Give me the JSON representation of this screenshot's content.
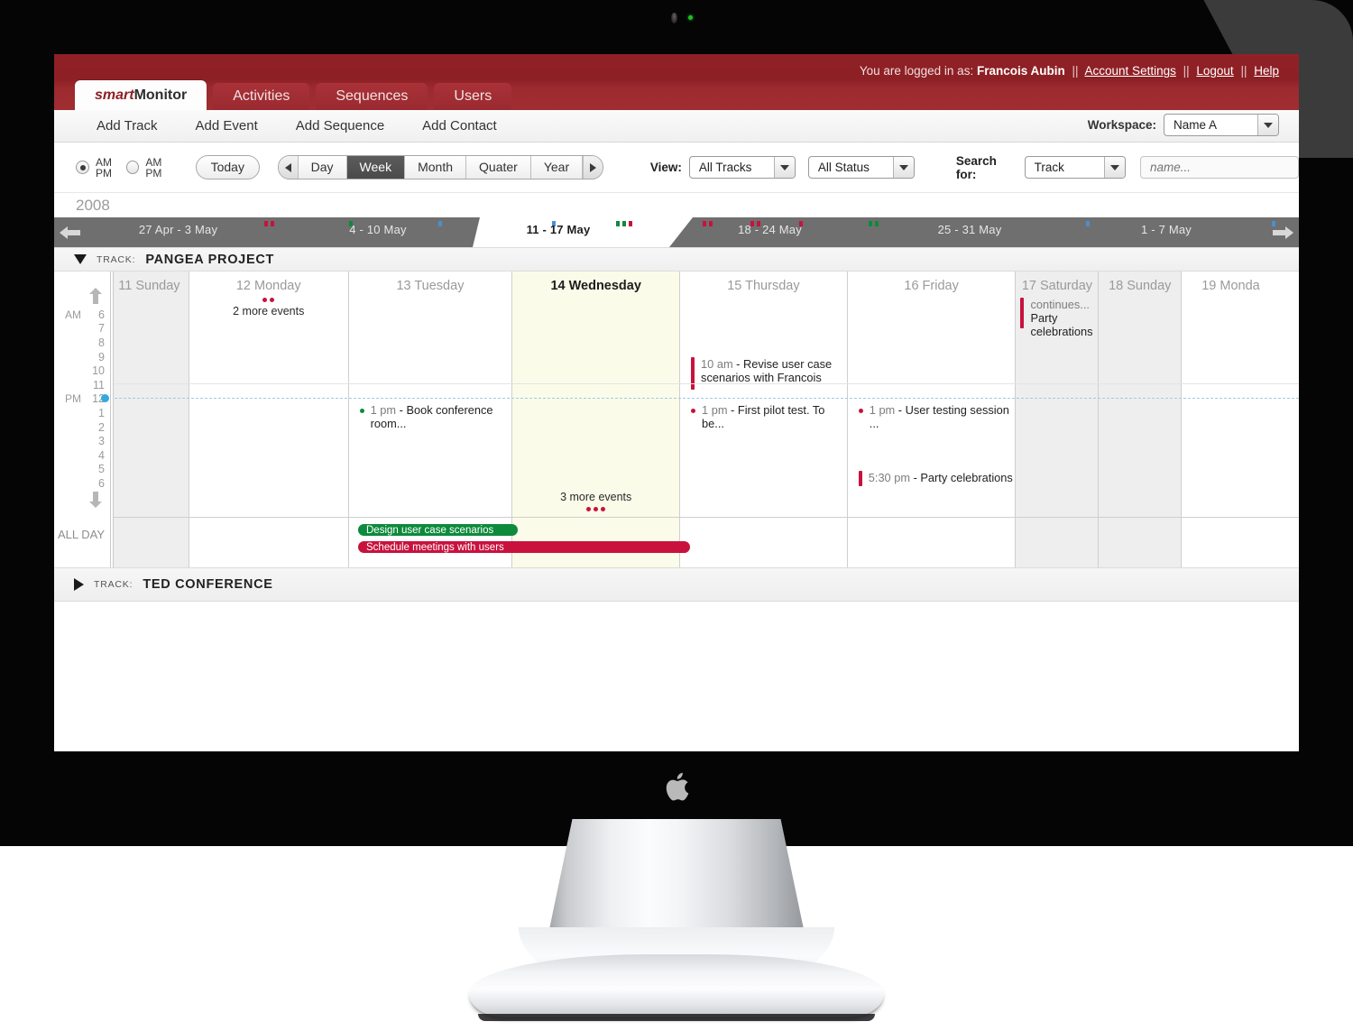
{
  "header": {
    "logged_in_prefix": "You are logged in as:",
    "user_name": "Francois Aubin",
    "separator": "||",
    "account_settings": "Account Settings",
    "logout": "Logout",
    "help": "Help",
    "tabs": [
      {
        "label": "smartMonitor",
        "brand_first": "smart",
        "brand_second": "Monitor",
        "active": true
      },
      {
        "label": "Activities",
        "active": false
      },
      {
        "label": "Sequences",
        "active": false
      },
      {
        "label": "Users",
        "active": false
      }
    ]
  },
  "subnav": {
    "links": [
      "Add Track",
      "Add Event",
      "Add Sequence",
      "Add Contact"
    ],
    "workspace_label": "Workspace:",
    "workspace_value": "Name A"
  },
  "toolbar": {
    "radio_ampm_stacked": {
      "line1": "AM",
      "line2": "PM",
      "selected": true
    },
    "radio_ampm_inline": {
      "label": "AM PM",
      "selected": false
    },
    "today_label": "Today",
    "range_buttons": [
      "Day",
      "Week",
      "Month",
      "Quater",
      "Year"
    ],
    "range_selected": "Week",
    "view_label": "View:",
    "view_tracks_value": "All Tracks",
    "view_status_value": "All Status",
    "search_label": "Search for:",
    "search_type_value": "Track",
    "search_placeholder": "name..."
  },
  "timeline": {
    "year": "2008",
    "weeks": [
      {
        "label": "27 Apr - 3  May",
        "current": false
      },
      {
        "label": "4 - 10  May",
        "current": false
      },
      {
        "label": "11 - 17  May",
        "current": true
      },
      {
        "label": "18 - 24  May",
        "current": false
      },
      {
        "label": "25 - 31  May",
        "current": false
      },
      {
        "label": "1 - 7  May",
        "current": false
      }
    ]
  },
  "tracks": [
    {
      "prefix": "TRACK:",
      "name": "PANGEA PROJECT",
      "expanded": true
    },
    {
      "prefix": "TRACK:",
      "name": "TED CONFERENCE",
      "expanded": false
    }
  ],
  "calendar": {
    "all_day_label": "ALL DAY",
    "meridiem_am": "AM",
    "meridiem_pm": "PM",
    "hours": [
      "6",
      "7",
      "8",
      "9",
      "10",
      "11",
      "12",
      "1",
      "2",
      "3",
      "4",
      "5",
      "6"
    ],
    "days": [
      {
        "label": "11 Sunday",
        "weekend": true,
        "today": false
      },
      {
        "label": "12 Monday",
        "weekend": false,
        "today": false
      },
      {
        "label": "13 Tuesday",
        "weekend": false,
        "today": false
      },
      {
        "label": "14 Wednesday",
        "weekend": false,
        "today": true
      },
      {
        "label": "15 Thursday",
        "weekend": false,
        "today": false
      },
      {
        "label": "16 Friday",
        "weekend": false,
        "today": false
      },
      {
        "label": "17 Saturday",
        "weekend": true,
        "today": false
      },
      {
        "label": "18 Sunday",
        "weekend": true,
        "today": false
      },
      {
        "label": "19 Monda",
        "weekend": false,
        "today": false
      }
    ],
    "more_events": [
      {
        "day": "12 Monday",
        "label": "2 more events",
        "count": 2
      },
      {
        "day": "14 Wednesday",
        "label": "3 more events",
        "count": 3
      }
    ],
    "events": [
      {
        "day": "17 Saturday",
        "continues": "continues...",
        "title": "Party celebrations",
        "color": "#c8123d",
        "style": "bar"
      },
      {
        "day": "15 Thursday",
        "time": "10 am",
        "title": "Revise user case scenarios with Francois",
        "color": "#c8123d",
        "style": "bar"
      },
      {
        "day": "13 Tuesday",
        "time": "1 pm",
        "title": "Book conference room...",
        "color": "#0d8a3c",
        "style": "dot"
      },
      {
        "day": "15 Thursday",
        "time": "1 pm",
        "title": "First pilot test. To be...",
        "color": "#c8123d",
        "style": "dot"
      },
      {
        "day": "16 Friday",
        "time": "1 pm",
        "title": "User testing session ...",
        "color": "#c8123d",
        "style": "dot"
      },
      {
        "day": "16 Friday",
        "time": "5:30 pm",
        "title": "Party celebrations",
        "color": "#c8123d",
        "style": "bar"
      }
    ],
    "all_day_events": [
      {
        "title": "Design user case scenarios",
        "color": "#0d8a3c",
        "start_day": "13 Tuesday",
        "span_days": 1
      },
      {
        "title": "Schedule meetings with users",
        "color": "#c8123d",
        "start_day": "13 Tuesday",
        "span_days": 2
      }
    ]
  },
  "colors": {
    "brand_red": "#8d2025",
    "event_red": "#c8123d",
    "event_green": "#0d8a3c",
    "event_blue": "#4a8fd0",
    "today_bg": "#fbfbe9",
    "weekend_bg": "#eeeeee",
    "noon_marker": "#35a8e0"
  }
}
